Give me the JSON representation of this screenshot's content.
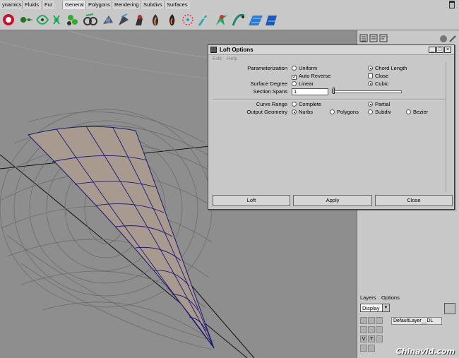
{
  "shelf_tabs": [
    "ynamics",
    "Fluids",
    "Fur",
    "General",
    "Polygons",
    "Rendering",
    "Subdivs",
    "Surfaces"
  ],
  "shelf_icons": [
    "dynamics-icon",
    "particle-icon",
    "emitter-icon",
    "field-icon",
    "collide-icon",
    "rigid-body-icon",
    "constraint-icon",
    "soft-body-icon",
    "goal-icon",
    "fire-icon",
    "smoke-icon",
    "fireworks-icon",
    "lightning-icon",
    "shatter-icon",
    "curve-flow-icon",
    "surface-flow-icon",
    "fluid-icon"
  ],
  "dialog": {
    "title": "Loft Options",
    "menu": {
      "edit": "Edit",
      "help": "Help"
    },
    "parameterization": {
      "label": "Parameterization",
      "options": [
        "Uniform",
        "Chord Length"
      ],
      "selected": "Chord Length"
    },
    "auto_reverse": {
      "label": "Auto Reverse",
      "checked": true
    },
    "close": {
      "label": "Close",
      "checked": false
    },
    "surface_degree": {
      "label": "Surface Degree",
      "options": [
        "Linear",
        "Cubic"
      ],
      "selected": "Cubic"
    },
    "section_spans": {
      "label": "Section Spans",
      "value": "1",
      "slider_value": "1"
    },
    "curve_range": {
      "label": "Curve Range",
      "options": [
        "Complete",
        "Partial"
      ],
      "selected": "Partial"
    },
    "output_geometry": {
      "label": "Output Geometry",
      "options": [
        "Nurbs",
        "Polygons",
        "Subdiv",
        "Bezier"
      ],
      "selected": "Nurbs"
    },
    "buttons": {
      "loft": "Loft",
      "apply": "Apply",
      "close": "Close"
    }
  },
  "layers": {
    "menu": {
      "layers": "Layers",
      "options": "Options"
    },
    "display": "Display",
    "default_layer": {
      "name": "DefaultLayer__DL",
      "v": "V",
      "t": "T"
    }
  },
  "watermark": "Chinavid.com"
}
